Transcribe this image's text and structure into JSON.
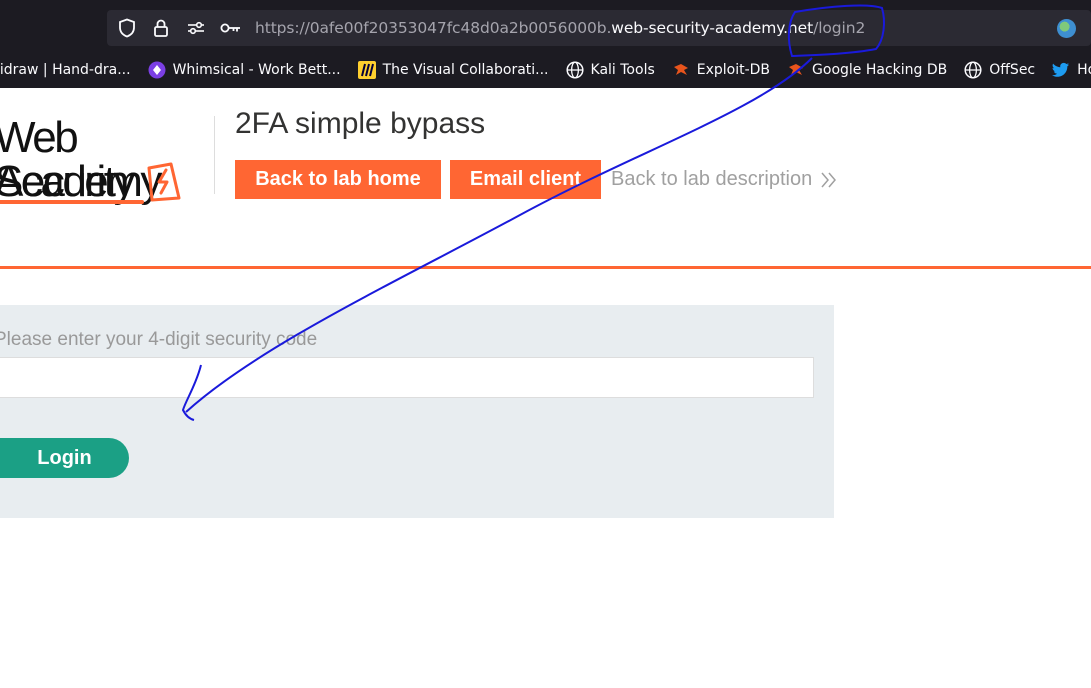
{
  "browser": {
    "url_scheme": "https://",
    "url_subdomain": "0afe00f20353047fc48d0a2b0056000b.",
    "url_domain": "web-security-academy.net",
    "url_path": "/login2"
  },
  "bookmarks": [
    {
      "label": "lidraw | Hand-dra...",
      "icon": "excalidraw-icon"
    },
    {
      "label": "Whimsical - Work Bett...",
      "icon": "whimsical-icon"
    },
    {
      "label": "The Visual Collaborati...",
      "icon": "miro-icon"
    },
    {
      "label": "Kali Tools",
      "icon": "globe-icon"
    },
    {
      "label": "Exploit-DB",
      "icon": "exploit-db-icon"
    },
    {
      "label": "Google Hacking DB",
      "icon": "exploit-db-icon"
    },
    {
      "label": "OffSec",
      "icon": "globe-icon"
    },
    {
      "label": "Home /",
      "icon": "twitter-icon"
    }
  ],
  "logo": {
    "line1": "Web Security",
    "line2": "Academy"
  },
  "header": {
    "title": "2FA simple bypass",
    "back_home": "Back to lab home",
    "email_client": "Email client",
    "back_description": "Back to lab description"
  },
  "form": {
    "label": "Please enter your 4-digit security code",
    "code_value": "",
    "login_label": "Login"
  },
  "colors": {
    "accent": "#ff6633",
    "login": "#1ba085",
    "annotation": "#1a1adb"
  }
}
